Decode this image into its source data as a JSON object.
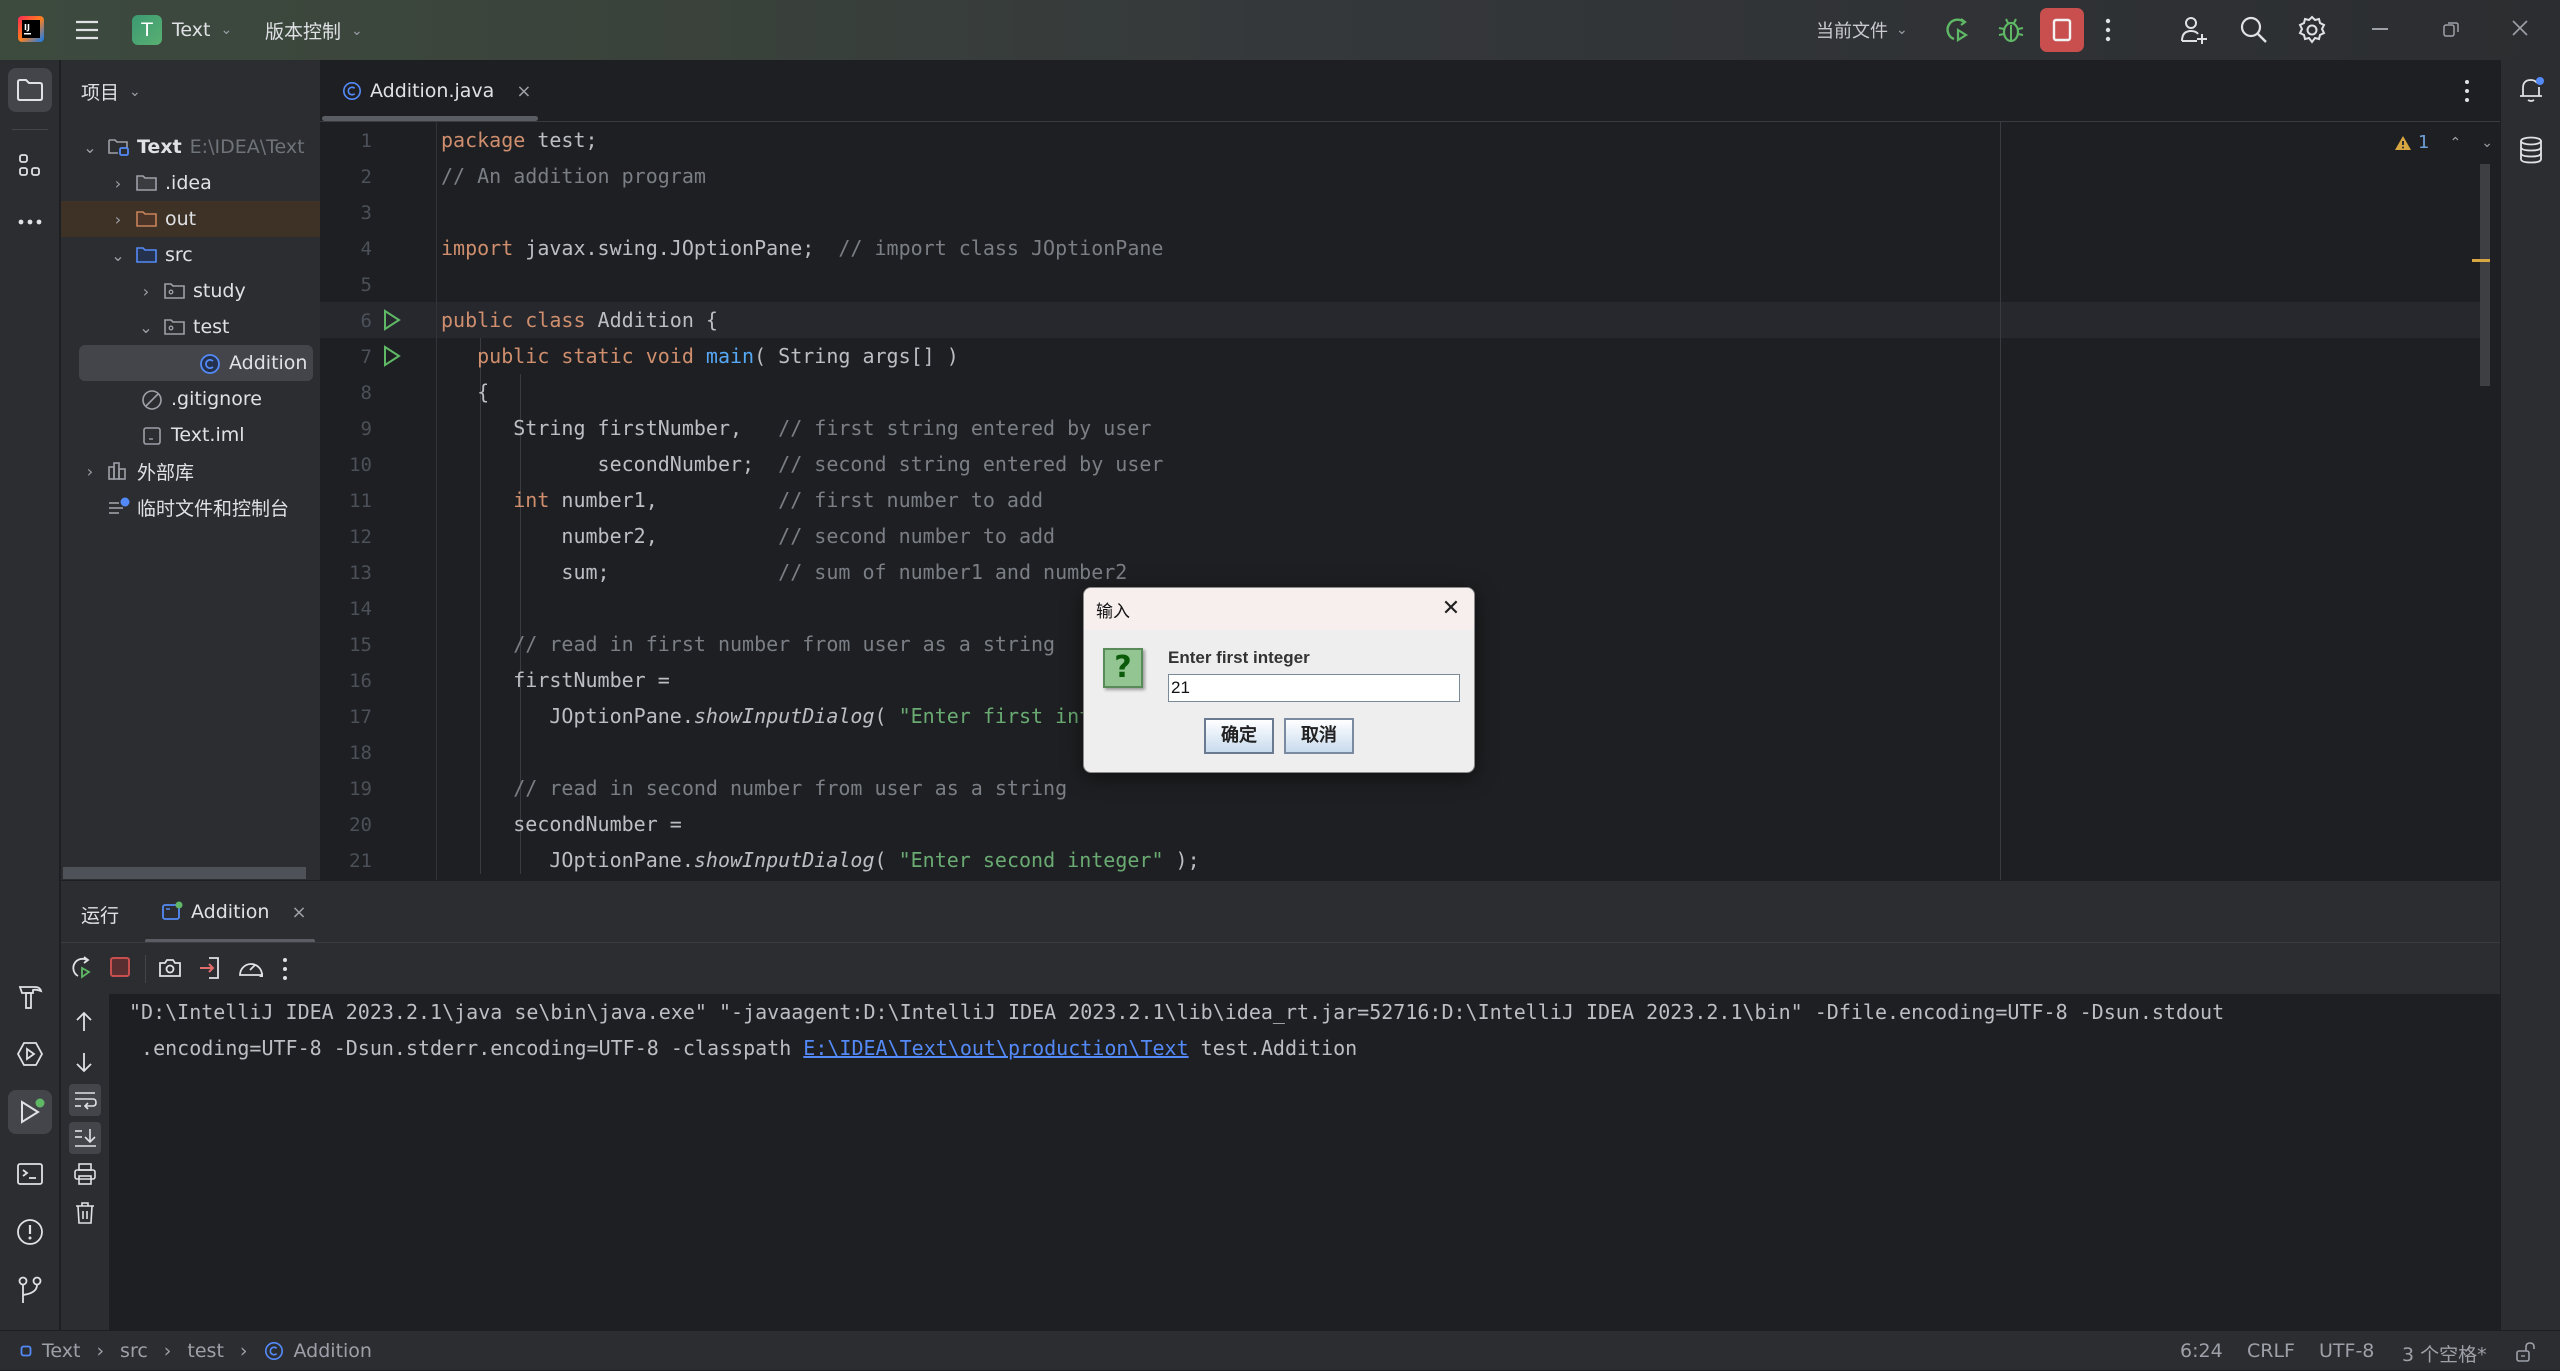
{
  "titlebar": {
    "project_badge": "T",
    "project_name": "Text",
    "vcs_menu": "版本控制",
    "run_config": "当前文件"
  },
  "project_panel": {
    "title": "项目",
    "tree": [
      {
        "label": "Text",
        "path": "E:\\IDEA\\Text",
        "type": "module",
        "expanded": true
      },
      {
        "label": ".idea",
        "type": "folder",
        "expanded": false
      },
      {
        "label": "out",
        "type": "folder-excluded",
        "expanded": false
      },
      {
        "label": "src",
        "type": "folder-source",
        "expanded": true
      },
      {
        "label": "study",
        "type": "package",
        "expanded": false
      },
      {
        "label": "test",
        "type": "package",
        "expanded": true
      },
      {
        "label": "Addition",
        "type": "class",
        "selected": true
      },
      {
        "label": ".gitignore",
        "type": "ignore-file"
      },
      {
        "label": "Text.iml",
        "type": "iml-file"
      },
      {
        "label": "外部库",
        "type": "libraries",
        "expanded": false
      },
      {
        "label": "临时文件和控制台",
        "type": "scratches"
      }
    ]
  },
  "editor": {
    "tab_label": "Addition.java",
    "warning_count": "1",
    "line_numbers": [
      "1",
      "2",
      "3",
      "4",
      "5",
      "6",
      "7",
      "8",
      "9",
      "10",
      "11",
      "12",
      "13",
      "14",
      "15",
      "16",
      "17",
      "18",
      "19",
      "20",
      "21"
    ],
    "lines": [
      [
        {
          "t": "package",
          "c": "kw"
        },
        {
          "t": " test;"
        }
      ],
      [
        {
          "t": "// An addition program",
          "c": "cm"
        }
      ],
      [],
      [
        {
          "t": "import",
          "c": "kw"
        },
        {
          "t": " javax.swing.JOptionPane;  "
        },
        {
          "t": "// import class JOptionPane",
          "c": "cm"
        }
      ],
      [],
      [
        {
          "t": "public class",
          "c": "kw"
        },
        {
          "t": " Addition {"
        }
      ],
      [
        {
          "t": "   "
        },
        {
          "t": "public static void",
          "c": "kw"
        },
        {
          "t": " "
        },
        {
          "t": "main",
          "c": "fn"
        },
        {
          "t": "( String args[] )"
        }
      ],
      [
        {
          "t": "   {"
        }
      ],
      [
        {
          "t": "      String firstNumber,   "
        },
        {
          "t": "// first string entered by user",
          "c": "cm"
        }
      ],
      [
        {
          "t": "             secondNumber;  "
        },
        {
          "t": "// second string entered by user",
          "c": "cm"
        }
      ],
      [
        {
          "t": "      "
        },
        {
          "t": "int",
          "c": "kw"
        },
        {
          "t": " number1,          "
        },
        {
          "t": "// first number to add",
          "c": "cm"
        }
      ],
      [
        {
          "t": "          number2,          "
        },
        {
          "t": "// second number to add",
          "c": "cm"
        }
      ],
      [
        {
          "t": "          sum;              "
        },
        {
          "t": "// sum of number1 and number2",
          "c": "cm"
        }
      ],
      [],
      [
        {
          "t": "      "
        },
        {
          "t": "// read in first number from user as a string",
          "c": "cm"
        }
      ],
      [
        {
          "t": "      firstNumber ="
        }
      ],
      [
        {
          "t": "         JOptionPane."
        },
        {
          "t": "showInputDialog",
          "c": "it"
        },
        {
          "t": "( "
        },
        {
          "t": "\"Enter first integer\"",
          "c": "str"
        },
        {
          "t": " );"
        }
      ],
      [],
      [
        {
          "t": "      "
        },
        {
          "t": "// read in second number from user as a string",
          "c": "cm"
        }
      ],
      [
        {
          "t": "      secondNumber ="
        }
      ],
      [
        {
          "t": "         JOptionPane."
        },
        {
          "t": "showInputDialog",
          "c": "it"
        },
        {
          "t": "( "
        },
        {
          "t": "\"Enter second integer\"",
          "c": "str"
        },
        {
          "t": " );"
        }
      ]
    ]
  },
  "run_panel": {
    "title": "运行",
    "tab_label": "Addition",
    "console_lines": [
      {
        "text": "\"D:\\IntelliJ IDEA 2023.2.1\\java se\\bin\\java.exe\" \"-javaagent:D:\\IntelliJ IDEA 2023.2.1\\lib\\idea_rt.jar=52716:D:\\IntelliJ IDEA 2023.2.1\\bin\" -Dfile.encoding=UTF-8 -Dsun.stdout"
      },
      {
        "prefix": " .encoding=UTF-8 -Dsun.stderr.encoding=UTF-8 -classpath ",
        "link": "E:\\IDEA\\Text\\out\\production\\Text",
        "suffix": " test.Addition"
      }
    ]
  },
  "dialog": {
    "title": "输入",
    "prompt": "Enter first integer",
    "input_value": "21",
    "ok_label": "确定",
    "cancel_label": "取消"
  },
  "statusbar": {
    "breadcrumb": [
      "Text",
      "src",
      "test",
      "Addition"
    ],
    "cursor_position": "6:24",
    "line_separator": "CRLF",
    "encoding": "UTF-8",
    "indent": "3 个空格*"
  },
  "colors": {
    "accent_blue": "#548af7",
    "stop_red": "#c94f4f",
    "run_green": "#5fb865",
    "warning_yellow": "#d7a640"
  }
}
